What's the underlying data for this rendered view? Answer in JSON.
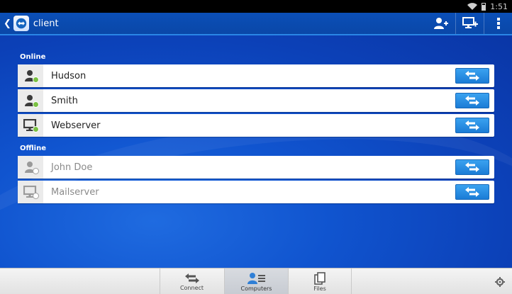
{
  "status_bar": {
    "time": "1:51"
  },
  "app": {
    "title": "client"
  },
  "sections": {
    "online": "Online",
    "offline": "Offline"
  },
  "contacts": {
    "online": [
      {
        "name": "Hudson",
        "type": "person-icon",
        "status": "online"
      },
      {
        "name": "Smith",
        "type": "person-icon",
        "status": "online"
      },
      {
        "name": "Webserver",
        "type": "monitor-icon",
        "status": "online"
      }
    ],
    "offline": [
      {
        "name": "John Doe",
        "type": "person-icon",
        "status": "offline"
      },
      {
        "name": "Mailserver",
        "type": "monitor-icon",
        "status": "offline"
      }
    ]
  },
  "tabs": [
    {
      "label": "Connect",
      "icon": "swap-arrows-icon",
      "active": false
    },
    {
      "label": "Computers",
      "icon": "contacts-list-icon",
      "active": true
    },
    {
      "label": "Files",
      "icon": "files-icon",
      "active": false
    }
  ],
  "colors": {
    "accent": "#1b7cd6",
    "online_dot": "#7ac143",
    "action_bar": "#0b4fb7"
  }
}
